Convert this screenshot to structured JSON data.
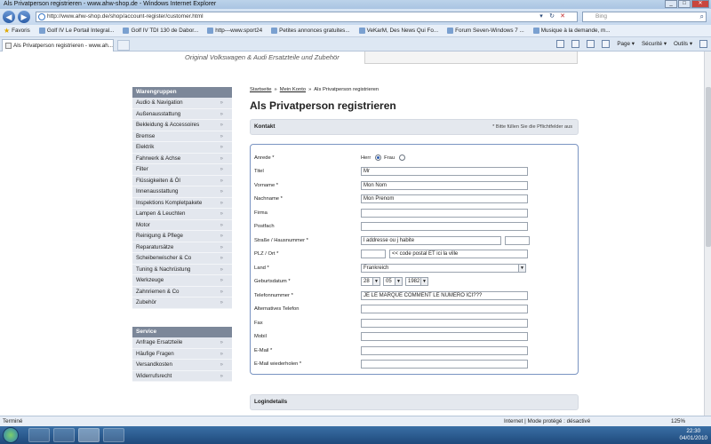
{
  "browser": {
    "window_title": "Als Privatperson registrieren - www.ahw-shop.de - Windows Internet Explorer",
    "url": "http://www.ahw-shop.de/shop/account-register/customer.html",
    "search_placeholder": "Bing",
    "favorites_label": "Favoris",
    "favorites": [
      "Golf IV  Le Portail Integral...",
      "Golf IV TDI 130 de Dabor...",
      "http---www.sport24",
      "Petites annonces gratuites...",
      "VeKarM, Des News Qui Fo...",
      "Forum Seven-Windows 7 ...",
      "Musique à la demande, m..."
    ],
    "tab_title": "Als Privatperson registrieren - www.ah...",
    "cmd_page": "Page ▾",
    "cmd_security": "Sécurité ▾",
    "cmd_tools": "Outils ▾",
    "status_left": "Terminé",
    "status_mode": "Internet | Mode protégé : désactivé",
    "zoom": "125%",
    "clock_time": "22:30",
    "clock_date": "04/01/2010"
  },
  "page": {
    "slogan": "Original Volkswagen & Audi Ersatzteile und Zubehör",
    "breadcrumb": [
      "Startseite",
      "Mein Konto",
      "Als Privatperson registrieren"
    ],
    "title": "Als Privatperson registrieren"
  },
  "sidebar": {
    "warengruppen_title": "Warengruppen",
    "warengruppen": [
      "Audio & Navigation",
      "Außenausstattung",
      "Bekleidung & Accessoires",
      "Bremse",
      "Elektrik",
      "Fahrwerk & Achse",
      "Filter",
      "Flüssigkeiten & Öl",
      "Innenausstattung",
      "Inspektions Kompletpakete",
      "Lampen & Leuchten",
      "Motor",
      "Reinigung & Pflege",
      "Reparatursätze",
      "Scheibenwischer & Co",
      "Tuning & Nachrüstung",
      "Werkzeuge",
      "Zahnriemen & Co",
      "Zubehör"
    ],
    "service_title": "Service",
    "service": [
      "Anfrage Ersatzteile",
      "Häufige Fragen",
      "Versandkosten",
      "Widerrufsrecht"
    ]
  },
  "form": {
    "section_title": "Kontakt",
    "required_note": "* Bitte füllen Sie die Pflichtfelder aus",
    "fields": {
      "anrede": "Anrede *",
      "herr": "Herr",
      "frau": "Frau",
      "titel": "Titel",
      "titel_val": "Mr",
      "vorname": "Vorname *",
      "vorname_val": "Mon Nom",
      "nachname": "Nachname *",
      "nachname_val": "Mon Prenom",
      "firma": "Firma",
      "postfach": "Postfach",
      "strasse": "Straße / Hausnummer *",
      "strasse_val": "l addresse ou j habite",
      "plz": "PLZ / Ort *",
      "plz_val": "<< code postal  ET ici la ville",
      "land": "Land *",
      "land_val": "Frankreich",
      "geburtsdatum": "Geburtsdatum *",
      "day": "28",
      "month": "05",
      "year": "1982",
      "telefon": "Telefonnummer *",
      "telefon_val": "JE LE MARQUE COMMENT LE NUMERO ICI???",
      "alt_telefon": "Alternatives Telefon",
      "fax": "Fax",
      "mobil": "Mobil",
      "email": "E-Mail *",
      "email_repeat": "E-Mail wiederholen *"
    },
    "login_section_title": "Logindetails"
  }
}
